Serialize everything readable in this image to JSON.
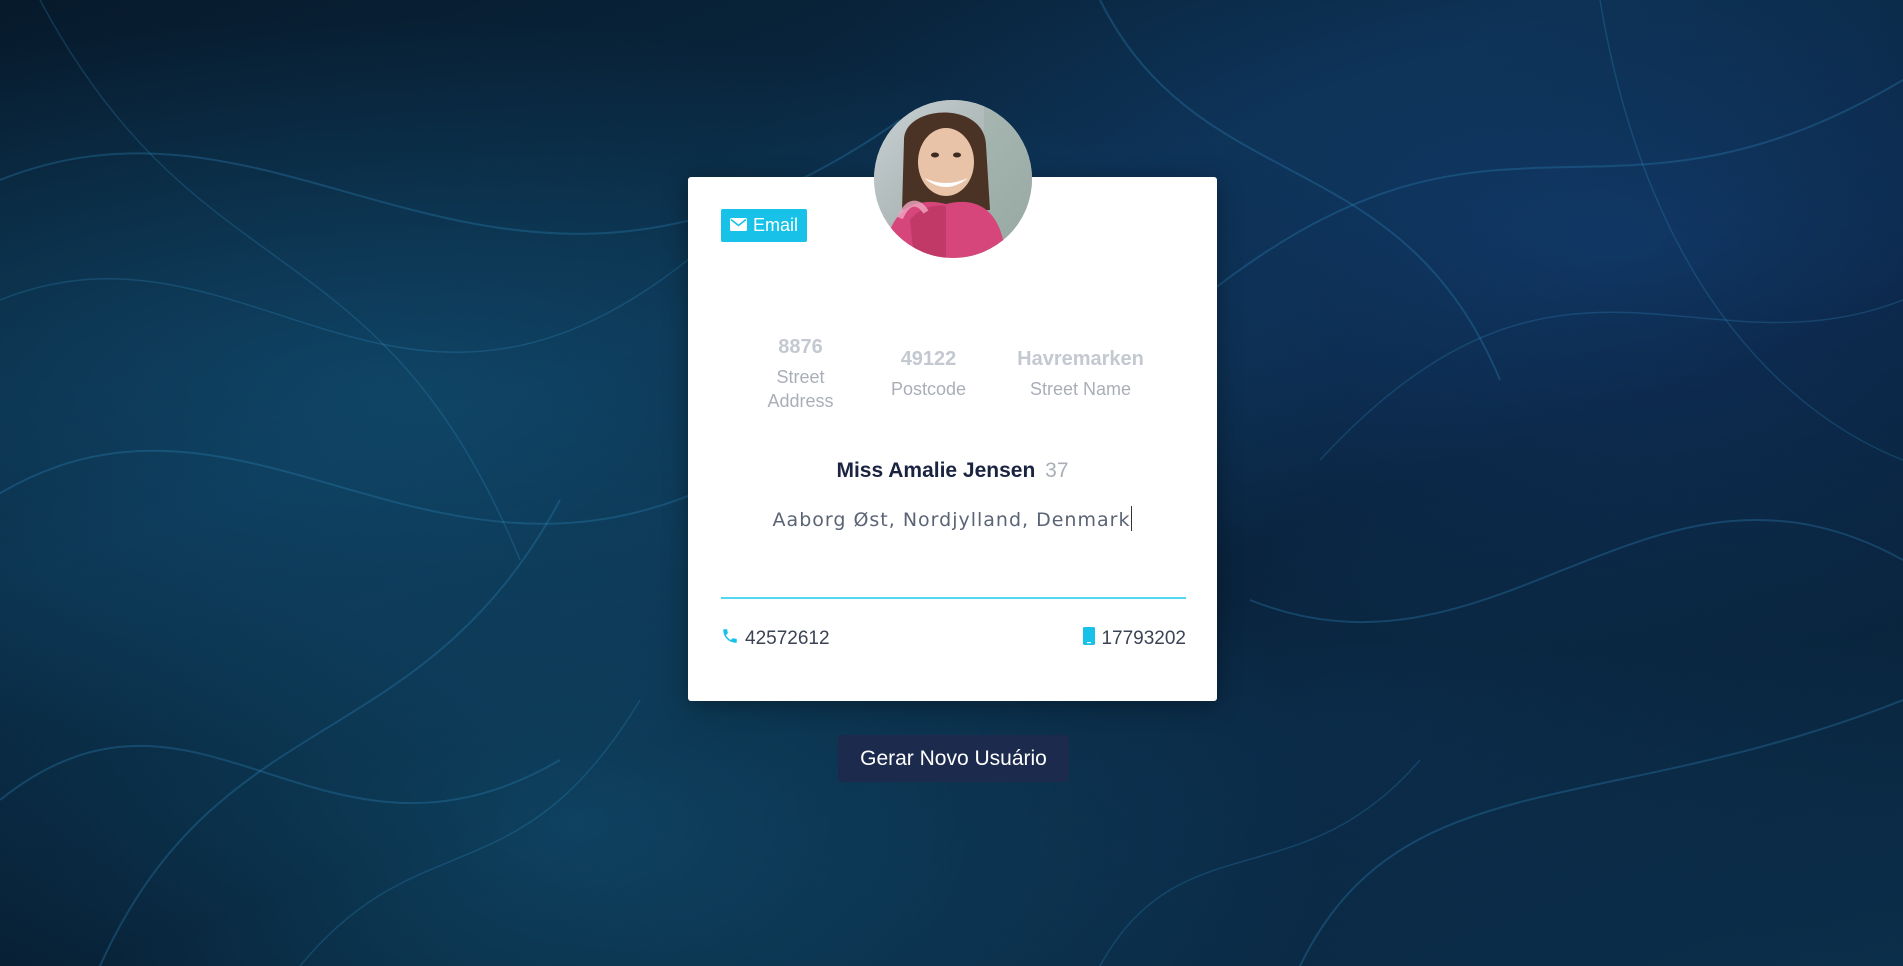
{
  "card": {
    "email_button": {
      "label": "Email",
      "icon": "envelope-icon"
    },
    "avatar": {
      "icon": "user-photo"
    },
    "stats": [
      {
        "value": "8876",
        "label": "Street Address"
      },
      {
        "value": "49122",
        "label": "Postcode"
      },
      {
        "value": "Havremarken",
        "label": "Street Name"
      }
    ],
    "name": "Miss Amalie Jensen",
    "age": "37",
    "location": "Aaborg Øst, Nordjylland, Denmark",
    "phone": {
      "icon": "phone-icon",
      "value": "42572612"
    },
    "cell": {
      "icon": "mobile-icon",
      "value": "17793202"
    }
  },
  "actions": {
    "generate_label": "Gerar Novo Usuário"
  },
  "colors": {
    "accent": "#17c1e8",
    "divider": "#4fd8ef",
    "button_bg": "#1c2b4d",
    "name_text": "#1a2340"
  }
}
